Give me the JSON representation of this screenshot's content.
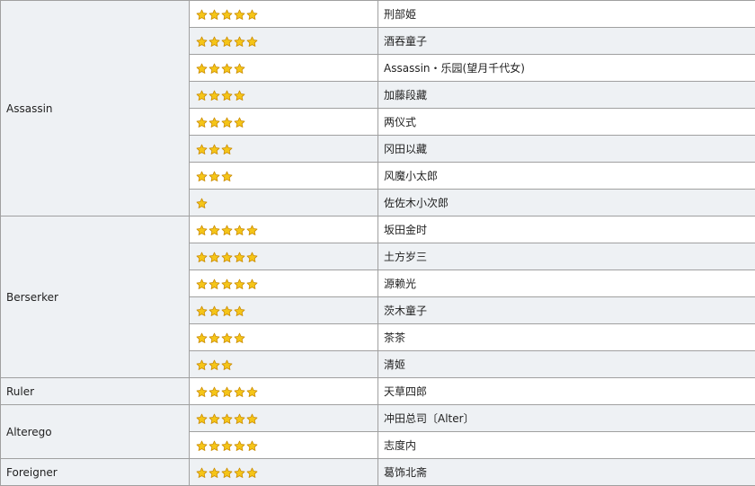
{
  "star_color": "#f5c518",
  "star_stroke": "#c98a00",
  "groups": [
    {
      "class": "Assassin",
      "rows": [
        {
          "stars": 5,
          "name": "刑部姫"
        },
        {
          "stars": 5,
          "name": "酒吞童子"
        },
        {
          "stars": 4,
          "name": "Assassin・乐园(望月千代女)"
        },
        {
          "stars": 4,
          "name": "加藤段藏"
        },
        {
          "stars": 4,
          "name": "两仪式"
        },
        {
          "stars": 3,
          "name": "冈田以藏"
        },
        {
          "stars": 3,
          "name": "风魔小太郎"
        },
        {
          "stars": 1,
          "name": "佐佐木小次郎"
        }
      ]
    },
    {
      "class": "Berserker",
      "rows": [
        {
          "stars": 5,
          "name": "坂田金时"
        },
        {
          "stars": 5,
          "name": "土方岁三"
        },
        {
          "stars": 5,
          "name": "源赖光"
        },
        {
          "stars": 4,
          "name": "茨木童子"
        },
        {
          "stars": 4,
          "name": "茶茶"
        },
        {
          "stars": 3,
          "name": "清姬"
        }
      ]
    },
    {
      "class": "Ruler",
      "rows": [
        {
          "stars": 5,
          "name": "天草四郎"
        }
      ]
    },
    {
      "class": "Alterego",
      "rows": [
        {
          "stars": 5,
          "name": "冲田总司〔Alter〕"
        },
        {
          "stars": 5,
          "name": "志度内"
        }
      ]
    },
    {
      "class": "Foreigner",
      "rows": [
        {
          "stars": 5,
          "name": "葛饰北斋"
        }
      ]
    }
  ]
}
